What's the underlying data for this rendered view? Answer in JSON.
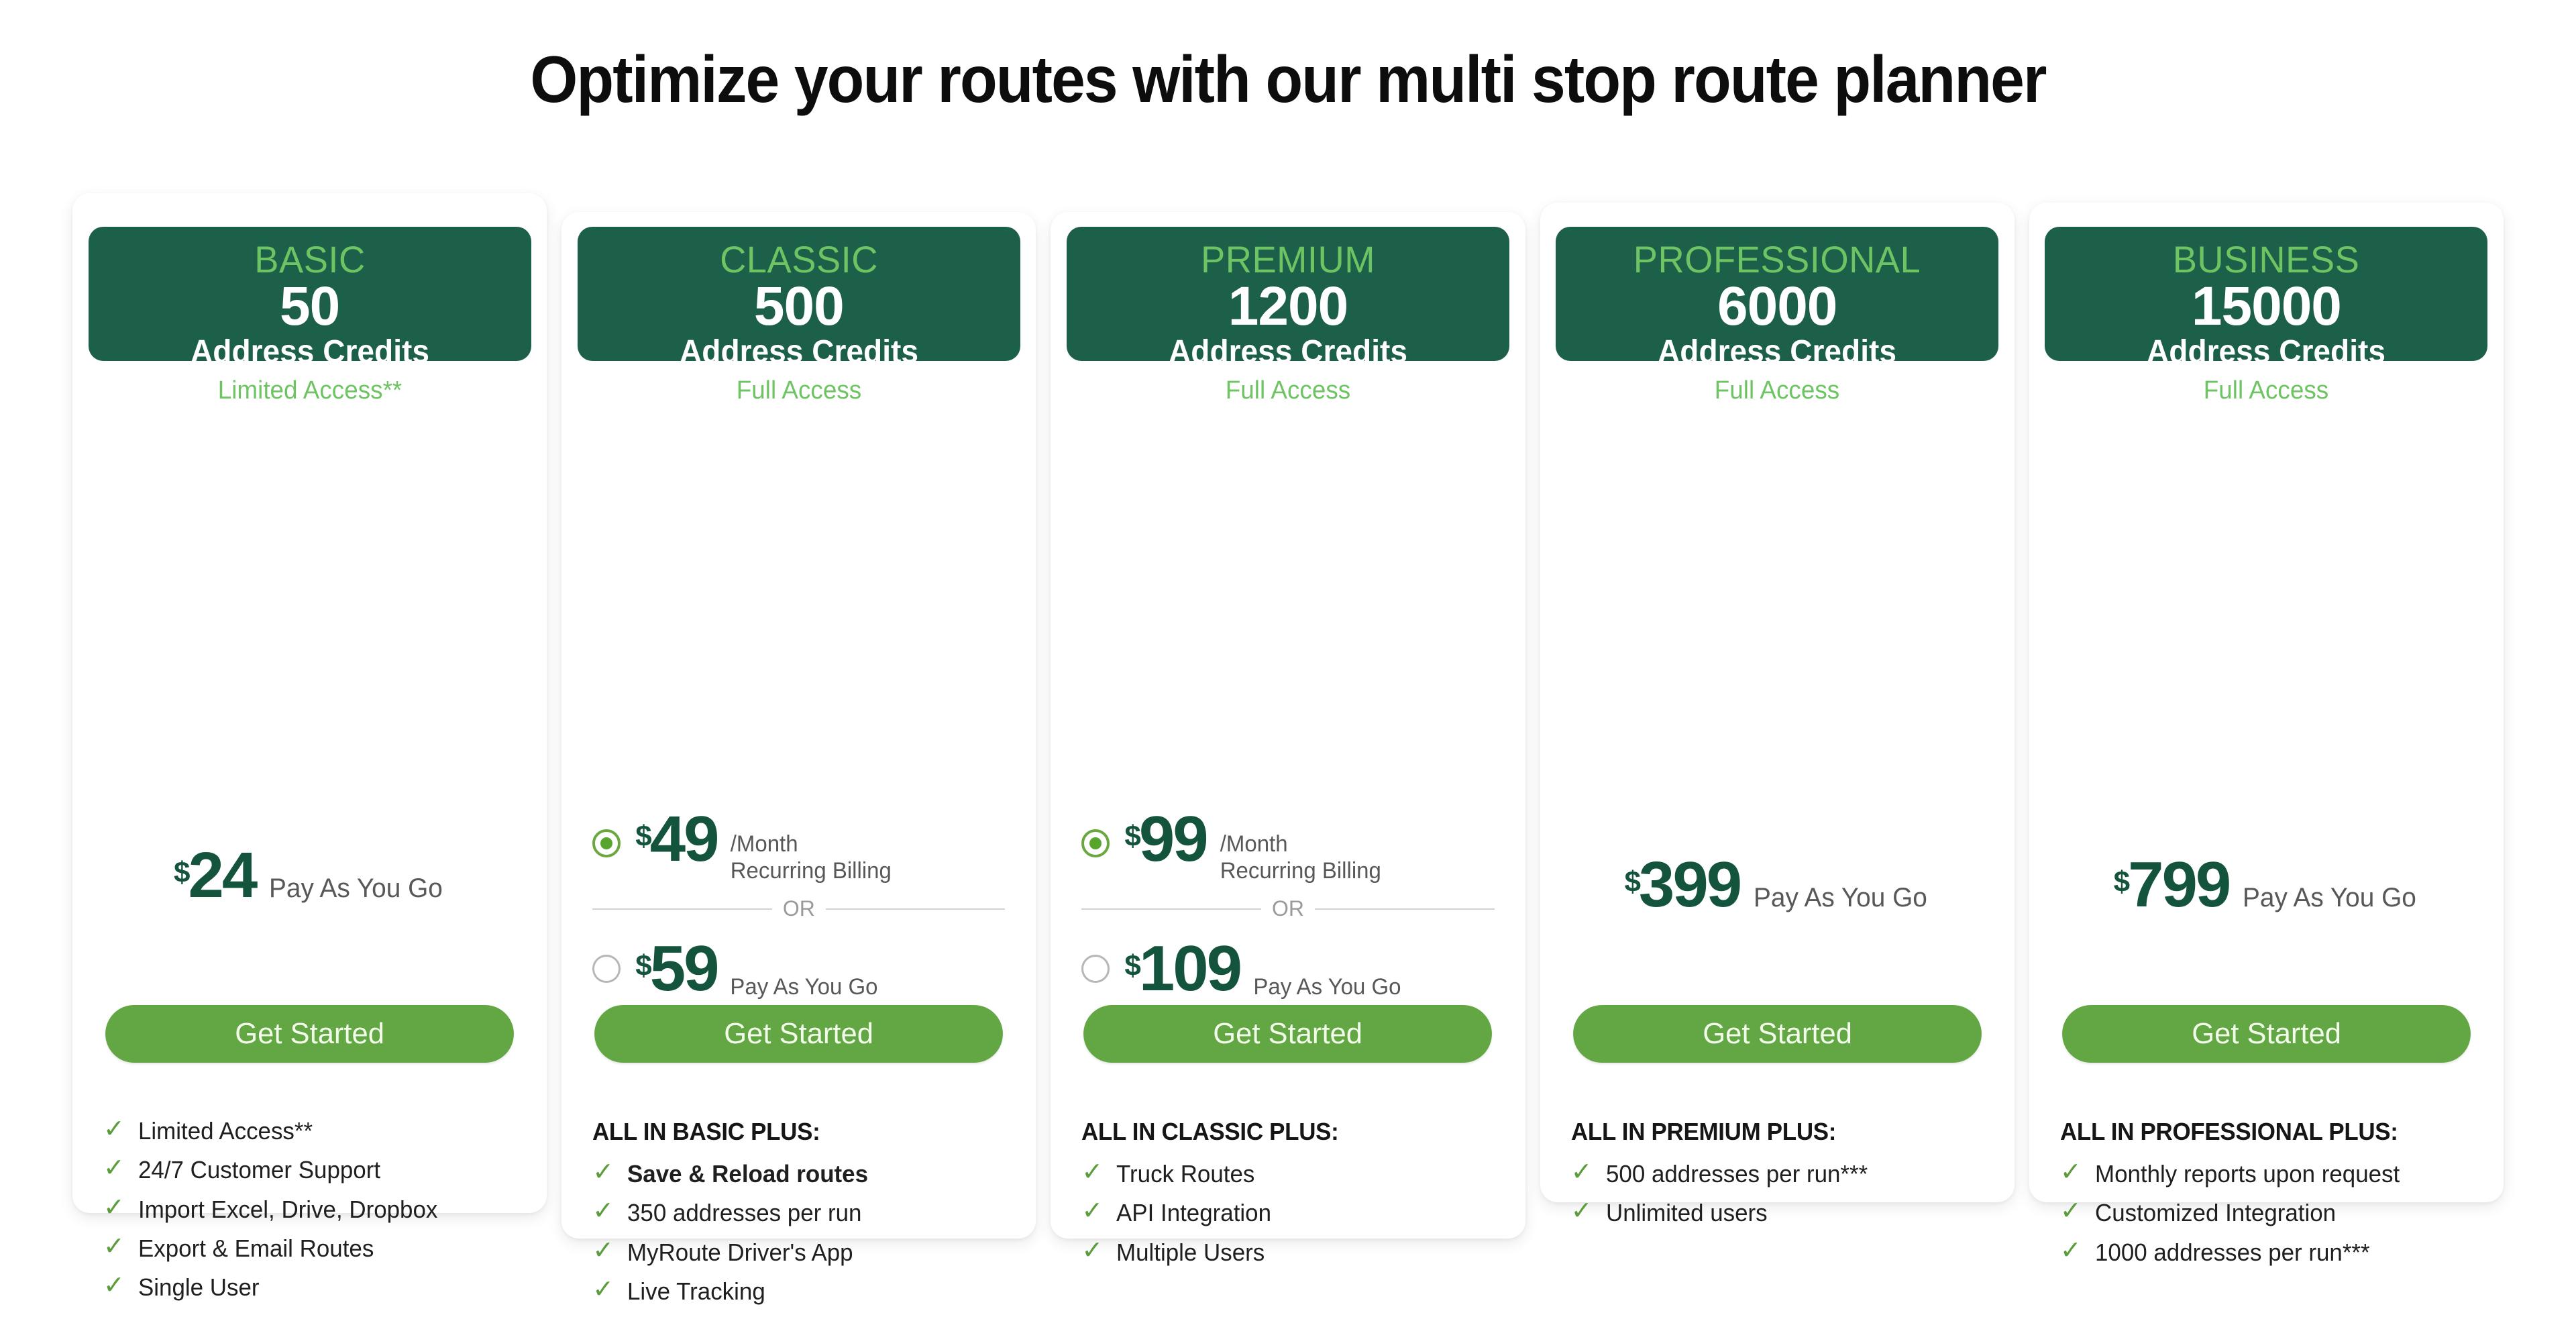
{
  "page": {
    "title": "Optimize your routes with our multi stop route planner"
  },
  "colors": {
    "header_green": "#1d6049",
    "accent_light_green": "#6ec463",
    "cta_green": "#62a744",
    "price_green": "#14543c",
    "check_green": "#5b9c3c"
  },
  "common": {
    "credits_label": "Address Credits",
    "cta_label": "Get Started",
    "or_label": "OR",
    "check_icon": "✓",
    "currency": "$"
  },
  "plans": [
    {
      "name": "BASIC",
      "credits": "50",
      "credits_label": "Address Credits",
      "access": "Limited Access**",
      "pricing_mode": "single",
      "price": {
        "currency": "$",
        "amount": "24",
        "label": "Pay As You Go"
      },
      "cta_label": "Get Started",
      "features_heading": "",
      "features": [
        {
          "text": "Limited Access**",
          "bold": false
        },
        {
          "text": "24/7 Customer Support",
          "bold": false
        },
        {
          "text": "Import Excel, Drive, Dropbox",
          "bold": false
        },
        {
          "text": "Export & Email Routes",
          "bold": false
        },
        {
          "text": "Single User",
          "bold": false
        }
      ]
    },
    {
      "name": "CLASSIC",
      "credits": "500",
      "credits_label": "Address Credits",
      "access": "Full Access",
      "pricing_mode": "dual",
      "options": [
        {
          "selected": true,
          "currency": "$",
          "amount": "49",
          "label_line1": "/Month",
          "label_line2": "Recurring Billing"
        },
        {
          "selected": false,
          "currency": "$",
          "amount": "59",
          "label_line1": "Pay As You Go",
          "label_line2": ""
        }
      ],
      "or_label": "OR",
      "cta_label": "Get Started",
      "features_heading": "ALL IN BASIC PLUS:",
      "features": [
        {
          "text": "Save & Reload routes",
          "bold": true
        },
        {
          "text": "350 addresses per run",
          "bold": false
        },
        {
          "text": "MyRoute Driver's App",
          "bold": false
        },
        {
          "text": "Live Tracking",
          "bold": false
        }
      ]
    },
    {
      "name": "PREMIUM",
      "credits": "1200",
      "credits_label": "Address Credits",
      "access": "Full Access",
      "pricing_mode": "dual",
      "options": [
        {
          "selected": true,
          "currency": "$",
          "amount": "99",
          "label_line1": "/Month",
          "label_line2": "Recurring Billing"
        },
        {
          "selected": false,
          "currency": "$",
          "amount": "109",
          "label_line1": "Pay As You Go",
          "label_line2": ""
        }
      ],
      "or_label": "OR",
      "cta_label": "Get Started",
      "features_heading": "ALL IN CLASSIC PLUS:",
      "features": [
        {
          "text": "Truck Routes",
          "bold": false
        },
        {
          "text": "API Integration",
          "bold": false
        },
        {
          "text": "Multiple Users",
          "bold": false
        }
      ]
    },
    {
      "name": "PROFESSIONAL",
      "credits": "6000",
      "credits_label": "Address Credits",
      "access": "Full Access",
      "pricing_mode": "single",
      "price": {
        "currency": "$",
        "amount": "399",
        "label": "Pay As You Go"
      },
      "cta_label": "Get Started",
      "features_heading": "ALL IN PREMIUM PLUS:",
      "features": [
        {
          "text": "500 addresses per run***",
          "bold": false
        },
        {
          "text": "Unlimited users",
          "bold": false
        }
      ]
    },
    {
      "name": "BUSINESS",
      "credits": "15000",
      "credits_label": "Address Credits",
      "access": "Full Access",
      "pricing_mode": "single",
      "price": {
        "currency": "$",
        "amount": "799",
        "label": "Pay As You Go"
      },
      "cta_label": "Get Started",
      "features_heading": "ALL IN PROFESSIONAL PLUS:",
      "features": [
        {
          "text": "Monthly reports upon request",
          "bold": false
        },
        {
          "text": "Customized Integration",
          "bold": false
        },
        {
          "text": "1000 addresses per run***",
          "bold": false
        }
      ]
    }
  ]
}
